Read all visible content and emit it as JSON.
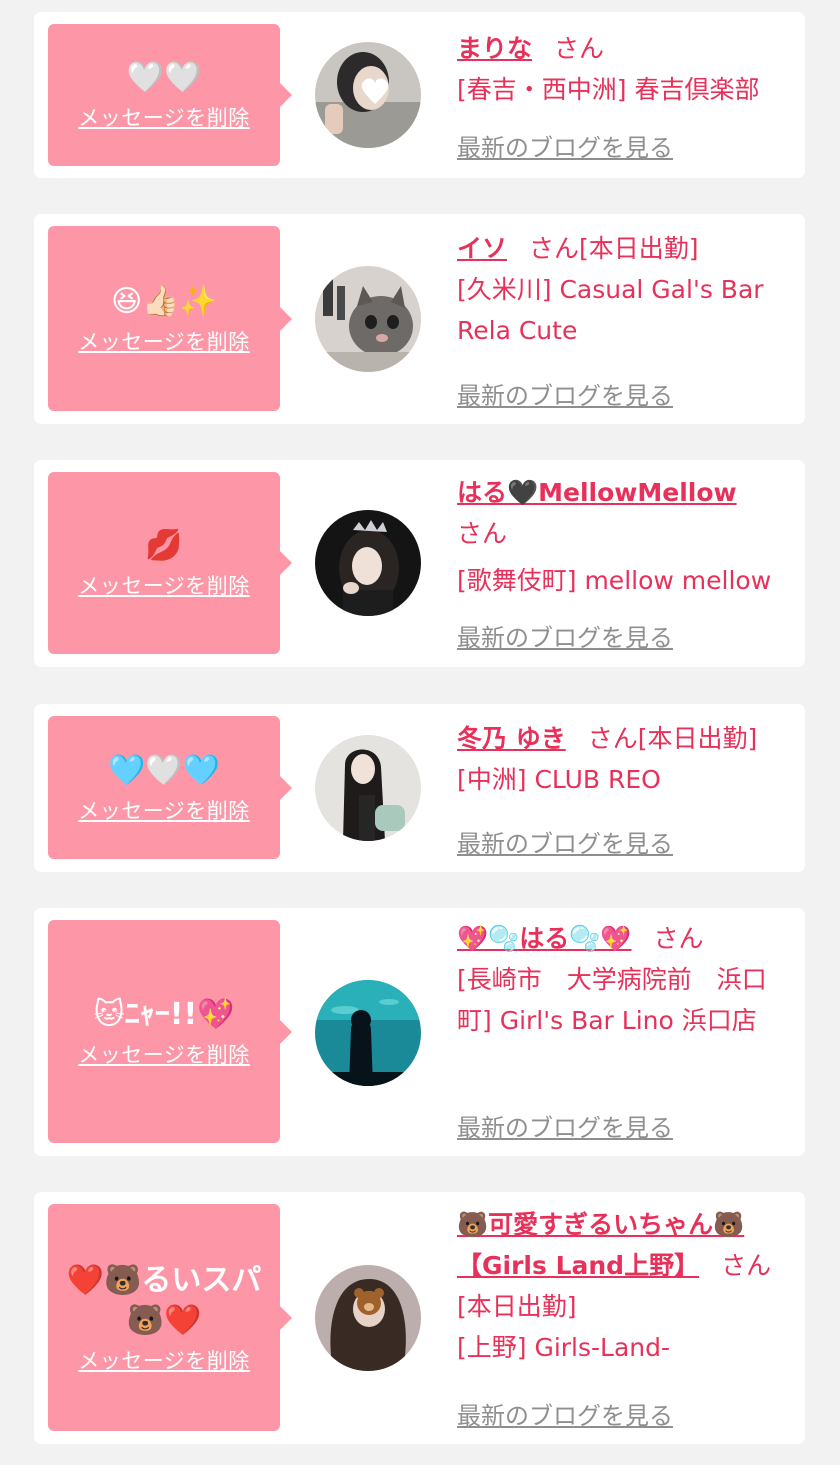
{
  "colors": {
    "background": "#f2f2f2",
    "card": "#ffffff",
    "message_box": "#fd97a8",
    "accent_pink": "#e8315a",
    "blog_link_gray": "#8f8f8f"
  },
  "common": {
    "delete_label": "メッセージを削除",
    "blog_label": "最新のブログを見る",
    "honorific": "さん"
  },
  "items": [
    {
      "message": "🤍🤍",
      "name": "まりな",
      "attendance": "",
      "shop": "[春吉・西中洲] 春吉倶楽部",
      "avatar_icon": "avatar-photo-heart-covered-face"
    },
    {
      "message": "😆👍🏻✨",
      "name": "イソ",
      "attendance": "[本日出勤]",
      "shop": "[久米川] Casual Gal's Bar Rela Cute",
      "avatar_icon": "avatar-photo-kitten"
    },
    {
      "message": "💋",
      "name": "はる🖤MellowMellow",
      "attendance": "",
      "shop": "[歌舞伎町] mellow mellow",
      "avatar_icon": "avatar-photo-tiara"
    },
    {
      "message": "🩵🤍🩵",
      "name": "冬乃 ゆき",
      "attendance": "[本日出勤]",
      "shop": "[中洲] CLUB REO",
      "avatar_icon": "avatar-photo-long-hair"
    },
    {
      "message": "🐱ﾆｬｰ!!💖",
      "name": "💖🫧はる🫧💖",
      "attendance": "",
      "shop": "[長崎市　大学病院前　浜口町] Girl's Bar Lino 浜口店",
      "avatar_icon": "avatar-photo-aquarium"
    },
    {
      "message": "❤️🐻るいスパ🐻❤️",
      "name": "🐻可愛すぎるいちゃん🐻【Girls Land上野】",
      "attendance": "[本日出勤]",
      "shop": "[上野] Girls-Land-",
      "avatar_icon": "avatar-photo-bear-covered-face"
    }
  ]
}
